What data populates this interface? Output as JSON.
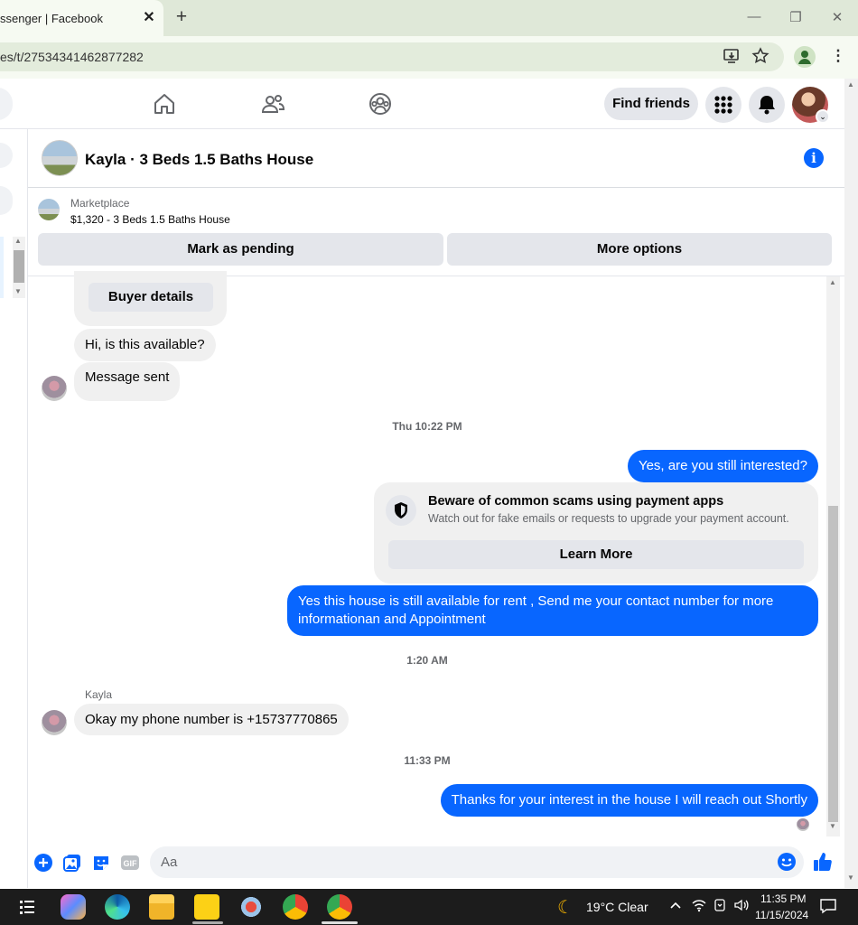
{
  "browser": {
    "tab_title": "ssenger | Facebook",
    "close_tab": "✕",
    "new_tab": "+",
    "url": "es/t/27534341462877282"
  },
  "fb_header": {
    "find_friends": "Find friends"
  },
  "chat": {
    "title": "Kayla · 3 Beds 1.5 Baths House",
    "info": "i"
  },
  "marketplace": {
    "label": "Marketplace",
    "item": "$1,320 - 3 Beds 1.5 Baths House",
    "mark_pending": "Mark as pending",
    "more_options": "More options"
  },
  "messages": {
    "buyer_details": "Buyer details",
    "msg1": "Hi, is this available?",
    "msg2": "Message sent",
    "ts1": "Thu 10:22 PM",
    "out1": "Yes, are you still interested?",
    "scam_title": "Beware of common scams using payment apps",
    "scam_sub": "Watch out for fake emails or requests to upgrade your payment account.",
    "learn_more": "Learn More",
    "out2": "Yes this house is still available for rent , Send me your contact number for more informationan and Appointment",
    "ts2": "1:20 AM",
    "sender": "Kayla",
    "in3": "Okay my phone number is +15737770865",
    "ts3": "11:33 PM",
    "out3": "Thanks for your interest in the house I will reach out Shortly"
  },
  "composer": {
    "placeholder": "Aa"
  },
  "taskbar": {
    "weather": "19°C  Clear",
    "time": "11:35 PM",
    "date": "11/15/2024"
  },
  "colors": {
    "messenger_blue": "#0866ff",
    "bubble_gray": "#f0f0f0",
    "chrome_green": "#dfe8d8"
  },
  "icons": [
    "home-icon",
    "friends-icon",
    "groups-icon",
    "menu-grid-icon",
    "bell-icon",
    "info-icon",
    "shield-icon",
    "plus-icon",
    "photo-icon",
    "sticker-icon",
    "gif-icon",
    "emoji-icon",
    "like-icon"
  ]
}
